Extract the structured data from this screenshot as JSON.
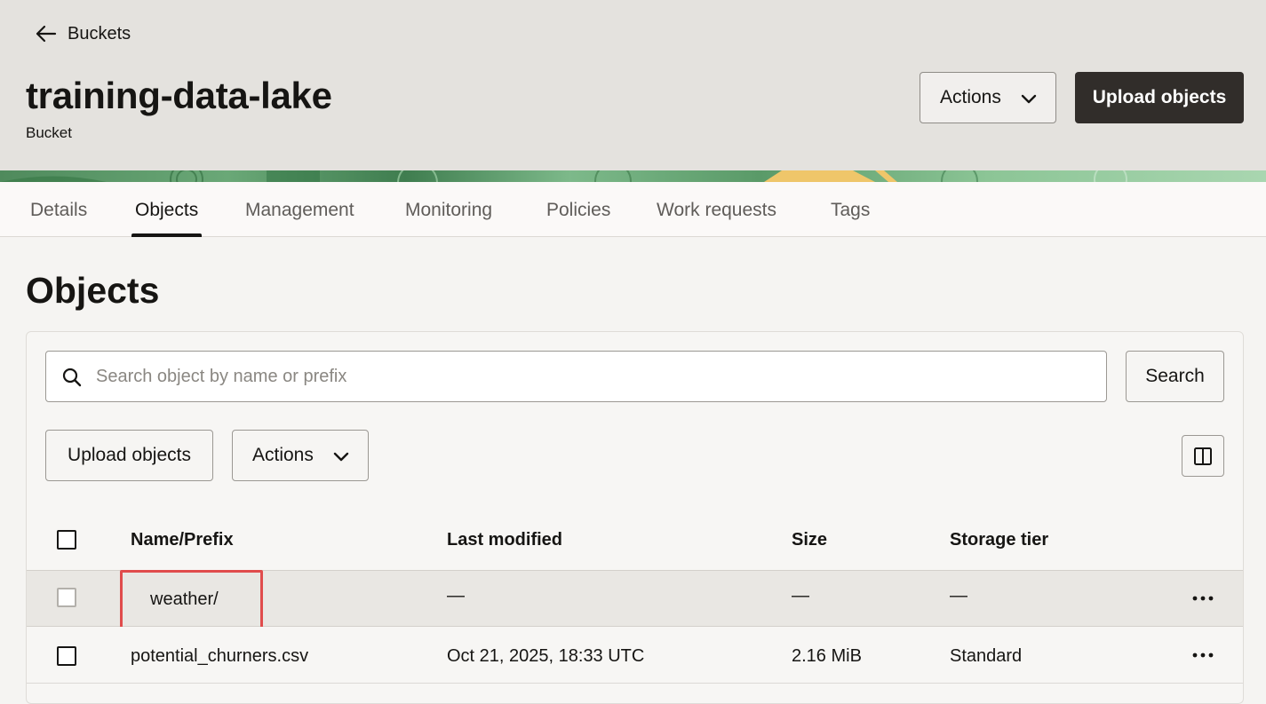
{
  "header": {
    "back_label": "Buckets",
    "title": "training-data-lake",
    "subtitle": "Bucket",
    "actions_label": "Actions",
    "upload_label": "Upload objects"
  },
  "tabs": [
    {
      "label": "Details"
    },
    {
      "label": "Objects"
    },
    {
      "label": "Management"
    },
    {
      "label": "Monitoring"
    },
    {
      "label": "Policies"
    },
    {
      "label": "Work requests"
    },
    {
      "label": "Tags"
    }
  ],
  "active_tab": "Objects",
  "objects": {
    "title": "Objects",
    "search_placeholder": "Search object by name or prefix",
    "search_button": "Search",
    "upload_button": "Upload objects",
    "actions_button": "Actions",
    "columns": {
      "name": "Name/Prefix",
      "modified": "Last modified",
      "size": "Size",
      "tier": "Storage tier"
    },
    "rows": [
      {
        "name": "weather/",
        "modified": "—",
        "size": "—",
        "tier": "—"
      },
      {
        "name": "potential_churners.csv",
        "modified": "Oct 21, 2025, 18:33 UTC",
        "size": "2.16 MiB",
        "tier": "Standard"
      }
    ]
  },
  "colors": {
    "primary_button": "#312d2a",
    "highlight_border": "#e04c4c",
    "header_bg": "#e4e2de"
  },
  "icons": {
    "back": "arrow-left-icon",
    "dropdown": "chevron-down-icon",
    "search": "search-icon",
    "columns": "columns-icon",
    "row_menu": "more-horizontal-icon"
  }
}
